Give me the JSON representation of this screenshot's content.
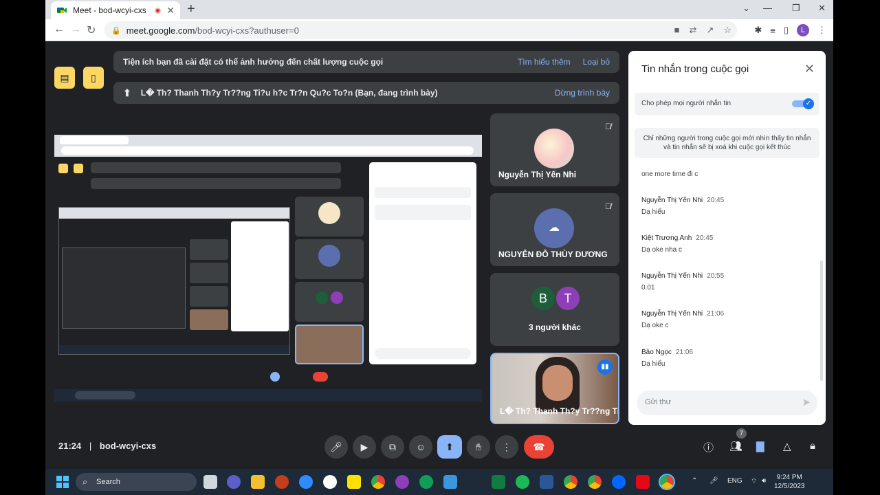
{
  "browser": {
    "tab_title": "Meet - bod-wcyi-cxs",
    "url_host": "meet.google.com",
    "url_path": "/bod-wcyi-cxs?authuser=0",
    "profile_initial": "L"
  },
  "banners": {
    "extensions_text": "Tiện ích bạn đã cài đặt có thể ảnh hưởng đến chất lượng cuộc gọi",
    "learn_more": "Tìm hiểu thêm",
    "dismiss": "Loại bỏ",
    "presenting_text": "L� Th? Thanh Th?y Tr??ng Ti?u h?c Tr?n Qu?c To?n (Bạn, đang trình bày)",
    "stop_presenting": "Dừng trình bày"
  },
  "participants": [
    {
      "name": "Nguyễn Thị Yến Nhi",
      "muted": true
    },
    {
      "name": "NGUYỄN ĐỖ THÙY DƯƠNG",
      "muted": true
    },
    {
      "name": "3 người khác",
      "initials": [
        "B",
        "T"
      ]
    },
    {
      "name": "L� Th? Thanh Th?y Tr??ng Ti..."
    }
  ],
  "chat": {
    "title": "Tin nhắn trong cuộc gọi",
    "allow_label": "Cho phép mọi người nhắn tin",
    "info": "Chỉ những người trong cuộc gọi mới nhìn thấy tin nhắn và tin nhắn sẽ bị xoá khi cuộc gọi kết thúc",
    "first_line": "one more time đi c",
    "messages": [
      {
        "sender": "Nguyễn Thị Yến Nhi",
        "time": "20:45",
        "text": "Dạ hiểu"
      },
      {
        "sender": "Kiệt Trương Anh",
        "time": "20:45",
        "text": "Dạ oke nha c"
      },
      {
        "sender": "Nguyễn Thị Yến Nhi",
        "time": "20:55",
        "text": "0.01"
      },
      {
        "sender": "Nguyễn Thị Yến Nhi",
        "time": "21:06",
        "text": "Dạ oke c"
      },
      {
        "sender": "Bảo Ngọc",
        "time": "21:06",
        "text": "Dạ hiểu"
      }
    ],
    "input_placeholder": "Gửi thư"
  },
  "meeting": {
    "time": "21:24",
    "separator": "|",
    "code": "bod-wcyi-cxs",
    "people_count": "7"
  },
  "taskbar": {
    "search": "Search",
    "lang": "ENG",
    "time": "9:24 PM",
    "date": "12/5/2023"
  },
  "colors": {
    "meet_bg": "#202124",
    "accent": "#8ab4f8",
    "hangup": "#ea4335",
    "warning": "#fdd663"
  }
}
